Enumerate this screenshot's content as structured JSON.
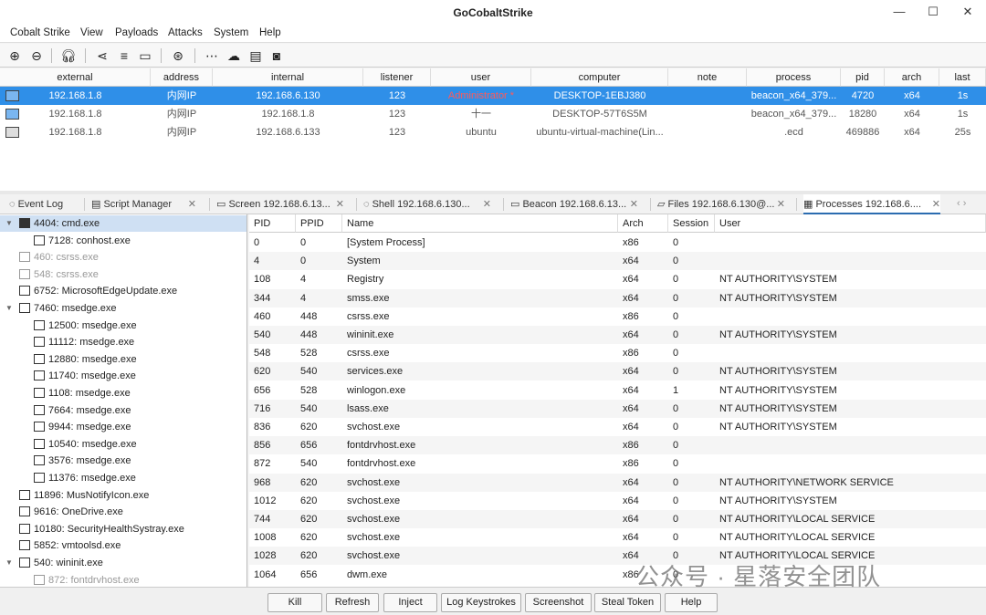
{
  "window": {
    "title": "GoCobaltStrike",
    "min": "—",
    "max": "☐",
    "close": "✕"
  },
  "menu": [
    "Cobalt Strike",
    "View",
    "Payloads",
    "Attacks",
    "System",
    "Help"
  ],
  "toolbar_icons": [
    "add-icon",
    "remove-icon",
    "headphones-icon",
    "share-icon",
    "list-icon",
    "laptop-icon",
    "globe-icon",
    "dots-icon",
    "cloud-download-icon",
    "terminal-icon",
    "camera-icon"
  ],
  "beacons": {
    "columns": [
      "external",
      "address",
      "internal",
      "listener",
      "user",
      "computer",
      "note",
      "process",
      "pid",
      "arch",
      "last"
    ],
    "rows": [
      {
        "external": "192.168.1.8",
        "address": "内网IP",
        "internal": "192.168.6.130",
        "listener": "123",
        "user": "Administrator *",
        "computer": "DESKTOP-1EBJ380",
        "note": "",
        "process": "beacon_x64_379...",
        "pid": "4720",
        "arch": "x64",
        "last": "1s",
        "selected": true
      },
      {
        "external": "192.168.1.8",
        "address": "内网IP",
        "internal": "192.168.1.8",
        "listener": "123",
        "user": "十一",
        "computer": "DESKTOP-57T6S5M",
        "note": "",
        "process": "beacon_x64_379...",
        "pid": "18280",
        "arch": "x64",
        "last": "1s"
      },
      {
        "external": "192.168.1.8",
        "address": "内网IP",
        "internal": "192.168.6.133",
        "listener": "123",
        "user": "ubuntu",
        "computer": "ubuntu-virtual-machine(Lin...",
        "note": "",
        "process": ".ecd",
        "pid": "469886",
        "arch": "x64",
        "last": "25s"
      }
    ]
  },
  "tabs": [
    {
      "label": "Event Log",
      "icon": "chat-icon",
      "close": false
    },
    {
      "label": "Script Manager",
      "icon": "document-icon",
      "close": true
    },
    {
      "label": "Screen 192.168.6.13...",
      "icon": "monitor-icon",
      "close": true
    },
    {
      "label": "Shell 192.168.6.130...",
      "icon": "chat-icon",
      "close": true
    },
    {
      "label": "Beacon 192.168.6.13...",
      "icon": "monitor-icon",
      "close": true
    },
    {
      "label": "Files 192.168.6.130@...",
      "icon": "folder-icon",
      "close": true
    },
    {
      "label": "Processes 192.168.6....",
      "icon": "clipboard-icon",
      "close": true,
      "active": true
    }
  ],
  "tree": [
    {
      "label": "4404: cmd.exe",
      "depth": 0,
      "toggle": "▼",
      "selected": true,
      "cmd": true
    },
    {
      "label": "7128: conhost.exe",
      "depth": 1
    },
    {
      "label": "460: csrss.exe",
      "depth": 0,
      "gray": true
    },
    {
      "label": "548: csrss.exe",
      "depth": 0,
      "gray": true
    },
    {
      "label": "6752: MicrosoftEdgeUpdate.exe",
      "depth": 0
    },
    {
      "label": "7460: msedge.exe",
      "depth": 0,
      "toggle": "▼"
    },
    {
      "label": "12500: msedge.exe",
      "depth": 1
    },
    {
      "label": "11112: msedge.exe",
      "depth": 1
    },
    {
      "label": "12880: msedge.exe",
      "depth": 1
    },
    {
      "label": "11740: msedge.exe",
      "depth": 1
    },
    {
      "label": "1108: msedge.exe",
      "depth": 1
    },
    {
      "label": "7664: msedge.exe",
      "depth": 1
    },
    {
      "label": "9944: msedge.exe",
      "depth": 1
    },
    {
      "label": "10540: msedge.exe",
      "depth": 1
    },
    {
      "label": "3576: msedge.exe",
      "depth": 1
    },
    {
      "label": "11376: msedge.exe",
      "depth": 1
    },
    {
      "label": "11896: MusNotifyIcon.exe",
      "depth": 0
    },
    {
      "label": "9616: OneDrive.exe",
      "depth": 0
    },
    {
      "label": "10180: SecurityHealthSystray.exe",
      "depth": 0
    },
    {
      "label": "5852: vmtoolsd.exe",
      "depth": 0
    },
    {
      "label": "540: wininit.exe",
      "depth": 0,
      "toggle": "▼"
    },
    {
      "label": "872: fontdrvhost.exe",
      "depth": 1,
      "gray": true
    }
  ],
  "processes": {
    "columns": [
      "PID",
      "PPID",
      "Name",
      "Arch",
      "Session",
      "User"
    ],
    "rows": [
      [
        "0",
        "0",
        "[System Process]",
        "x86",
        "0",
        ""
      ],
      [
        "4",
        "0",
        "System",
        "x64",
        "0",
        ""
      ],
      [
        "108",
        "4",
        "Registry",
        "x64",
        "0",
        "NT AUTHORITY\\SYSTEM"
      ],
      [
        "344",
        "4",
        "smss.exe",
        "x64",
        "0",
        "NT AUTHORITY\\SYSTEM"
      ],
      [
        "460",
        "448",
        "csrss.exe",
        "x86",
        "0",
        ""
      ],
      [
        "540",
        "448",
        "wininit.exe",
        "x64",
        "0",
        "NT AUTHORITY\\SYSTEM"
      ],
      [
        "548",
        "528",
        "csrss.exe",
        "x86",
        "0",
        ""
      ],
      [
        "620",
        "540",
        "services.exe",
        "x64",
        "0",
        "NT AUTHORITY\\SYSTEM"
      ],
      [
        "656",
        "528",
        "winlogon.exe",
        "x64",
        "1",
        "NT AUTHORITY\\SYSTEM"
      ],
      [
        "716",
        "540",
        "lsass.exe",
        "x64",
        "0",
        "NT AUTHORITY\\SYSTEM"
      ],
      [
        "836",
        "620",
        "svchost.exe",
        "x64",
        "0",
        "NT AUTHORITY\\SYSTEM"
      ],
      [
        "856",
        "656",
        "fontdrvhost.exe",
        "x86",
        "0",
        ""
      ],
      [
        "872",
        "540",
        "fontdrvhost.exe",
        "x86",
        "0",
        ""
      ],
      [
        "968",
        "620",
        "svchost.exe",
        "x64",
        "0",
        "NT AUTHORITY\\NETWORK SERVICE"
      ],
      [
        "1012",
        "620",
        "svchost.exe",
        "x64",
        "0",
        "NT AUTHORITY\\SYSTEM"
      ],
      [
        "744",
        "620",
        "svchost.exe",
        "x64",
        "0",
        "NT AUTHORITY\\LOCAL SERVICE"
      ],
      [
        "1008",
        "620",
        "svchost.exe",
        "x64",
        "0",
        "NT AUTHORITY\\LOCAL SERVICE"
      ],
      [
        "1028",
        "620",
        "svchost.exe",
        "x64",
        "0",
        "NT AUTHORITY\\LOCAL SERVICE"
      ],
      [
        "1064",
        "656",
        "dwm.exe",
        "x86",
        "0",
        ""
      ]
    ]
  },
  "buttons": [
    "Kill",
    "Refresh",
    "Inject",
    "Log Keystrokes",
    "Screenshot",
    "Steal Token",
    "Help"
  ],
  "watermark": "公众号 · 星落安全团队",
  "colors": {
    "selection": "#2f8fe8",
    "user_highlight": "#ff5a5a",
    "accent": "#2b6cb0"
  }
}
